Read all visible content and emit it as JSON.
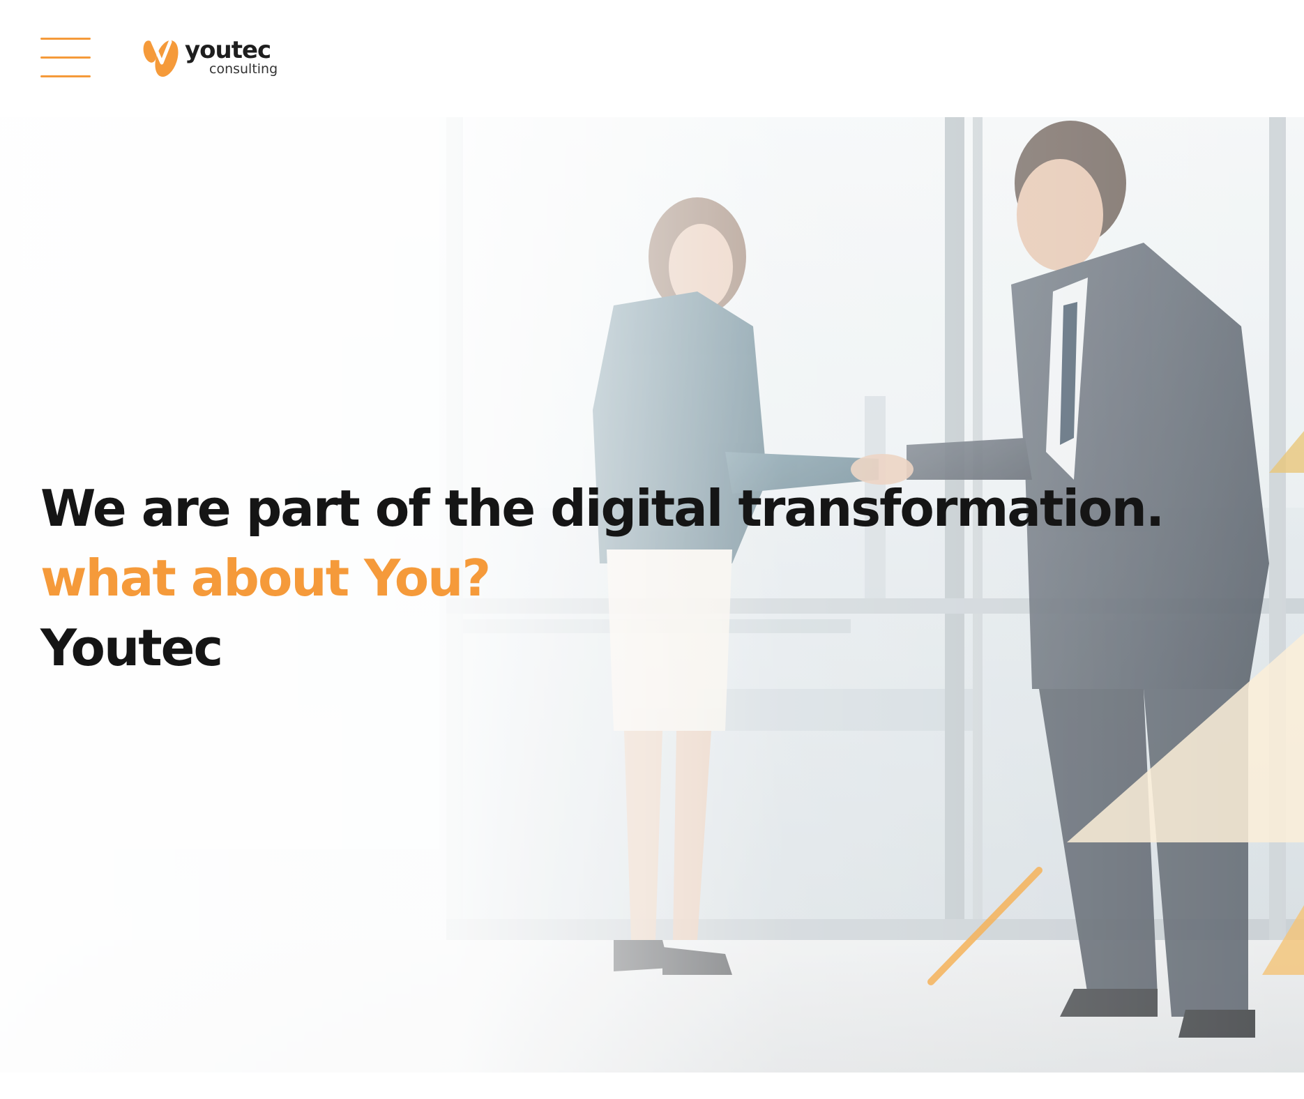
{
  "header": {
    "menu_icon": "hamburger-menu-icon",
    "logo": {
      "word": "youtec",
      "sub": "consulting",
      "icon": "youtec-logo-icon"
    }
  },
  "hero": {
    "line1": "We are part of the digital transformation.",
    "line2": "what about You?",
    "line3": "Youtec",
    "image": "business-handshake-photo"
  },
  "colors": {
    "accent": "#f59a3a",
    "heading": "#151515",
    "background": "#ffffff"
  }
}
